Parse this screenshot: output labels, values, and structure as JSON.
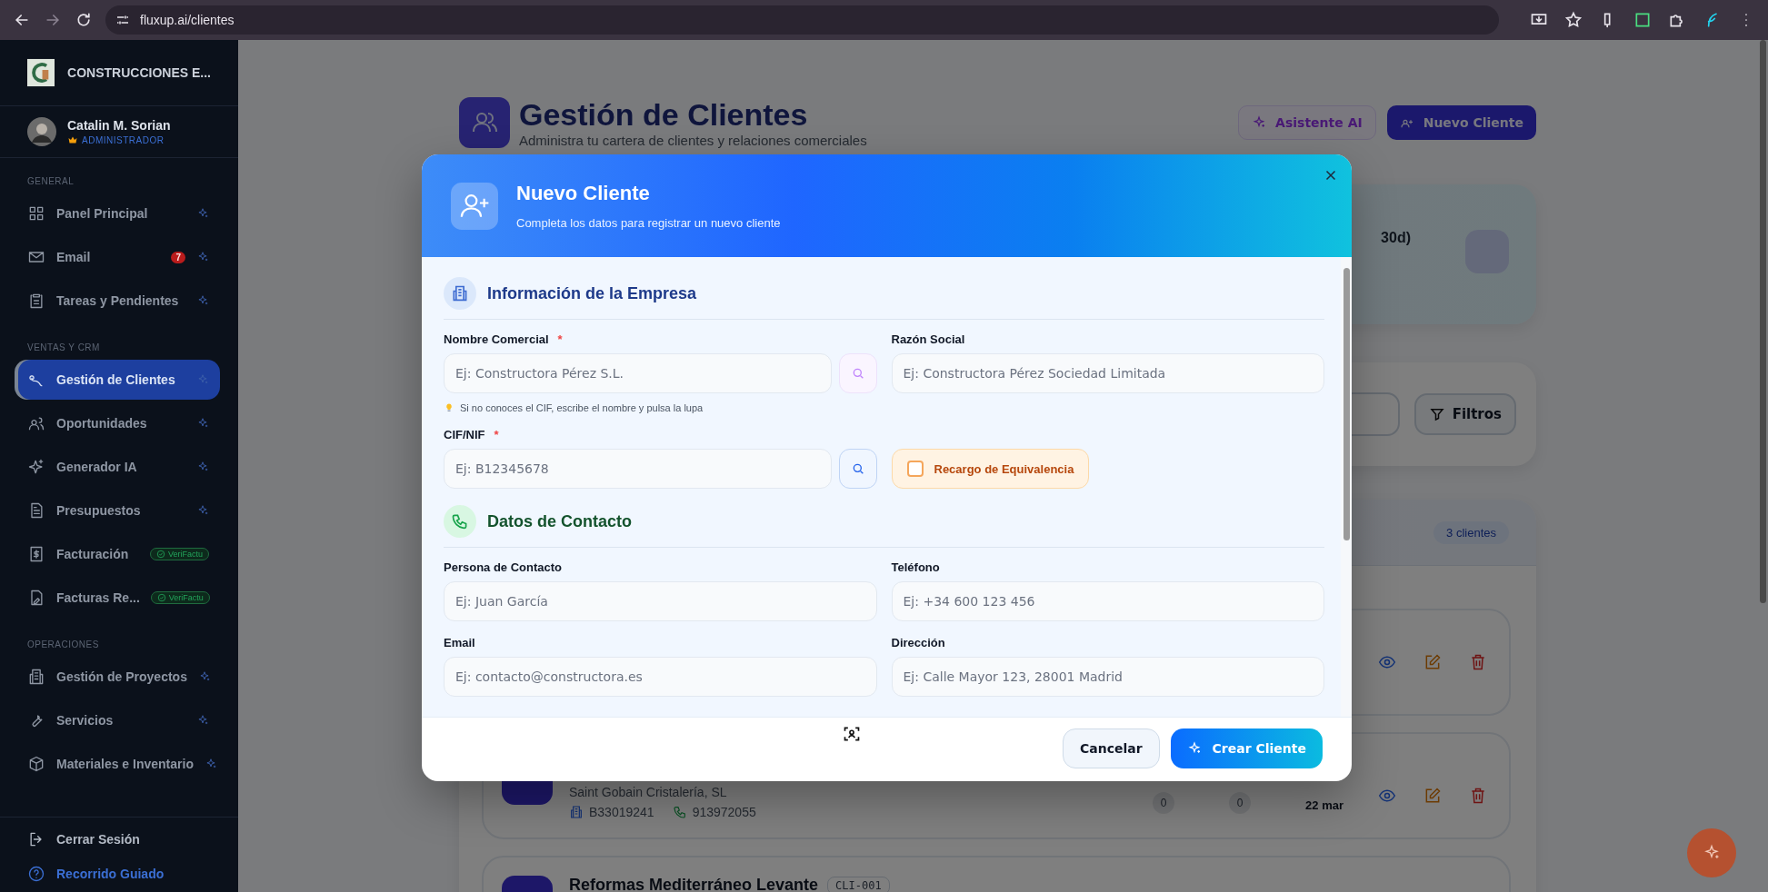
{
  "browser": {
    "url": "fluxup.ai/clientes"
  },
  "sidebar": {
    "company": "CONSTRUCCIONES E...",
    "user": {
      "name": "Catalin M. Sorian",
      "role": "ADMINISTRADOR"
    },
    "sections": [
      {
        "title": "GENERAL",
        "items": [
          {
            "label": "Panel Principal",
            "selected": false
          },
          {
            "label": "Email",
            "badge": "7",
            "selected": false
          },
          {
            "label": "Tareas y Pendientes",
            "selected": false
          }
        ]
      },
      {
        "title": "VENTAS Y CRM",
        "items": [
          {
            "label": "Gestión de Clientes",
            "selected": true
          },
          {
            "label": "Oportunidades",
            "selected": false
          },
          {
            "label": "Generador IA",
            "selected": false
          },
          {
            "label": "Presupuestos",
            "selected": false
          },
          {
            "label": "Facturación",
            "tag": "VeriFactu",
            "selected": false
          },
          {
            "label": "Facturas Re...",
            "tag": "VeriFactu",
            "selected": false
          }
        ]
      },
      {
        "title": "OPERACIONES",
        "items": [
          {
            "label": "Gestión de Proyectos",
            "selected": false
          },
          {
            "label": "Servicios",
            "selected": false
          },
          {
            "label": "Materiales e Inventario",
            "selected": false
          }
        ]
      }
    ],
    "footer": [
      {
        "label": "Cerrar Sesión",
        "kind": "logout"
      },
      {
        "label": "Recorrido Guiado",
        "kind": "guide"
      }
    ]
  },
  "page": {
    "title": "Gestión de Clientes",
    "subtitle": "Administra tu cartera de clientes y relaciones comerciales",
    "actions": [
      {
        "label": "Asistente AI",
        "kind": "ai"
      },
      {
        "label": "Nuevo Cliente",
        "kind": "primary"
      }
    ]
  },
  "stats_card": {
    "text": "30d)"
  },
  "filters": {
    "button": "Filtros"
  },
  "client_list": {
    "count": "3 clientes",
    "clients": [
      {
        "kind": "covered"
      },
      {
        "kind": "partial",
        "legal_name": "Saint Gobain Cristalería, SL",
        "cif": "B33019241",
        "phone": "913972055",
        "stats": [
          "0",
          "0"
        ],
        "created": "22 mar"
      },
      {
        "kind": "top",
        "name": "Reformas Mediterráneo Levante",
        "code": "CLI-001"
      }
    ]
  },
  "modal": {
    "title": "Nuevo Cliente",
    "subtitle": "Completa los datos para registrar un nuevo cliente",
    "sections": [
      {
        "title": "Información de la Empresa",
        "kind": "company",
        "fields": [
          {
            "label": "Nombre Comercial",
            "required_mark": "*",
            "placeholder": "Ej: Constructora Pérez S.L.",
            "kind": "lookup-ai",
            "hint": "Si no conoces el CIF, escribe el nombre y pulsa la lupa"
          },
          {
            "label": "Razón Social",
            "placeholder": "Ej: Constructora Pérez Sociedad Limitada",
            "kind": "text"
          },
          {
            "label": "CIF/NIF",
            "required_mark": "*",
            "placeholder": "Ej: B12345678",
            "kind": "lookup"
          },
          {
            "label": "Recargo de Equivalencia",
            "kind": "checkbox",
            "checked": false
          }
        ]
      },
      {
        "title": "Datos de Contacto",
        "kind": "contact",
        "fields": [
          {
            "label": "Persona de Contacto",
            "placeholder": "Ej: Juan García",
            "kind": "text"
          },
          {
            "label": "Teléfono",
            "placeholder": "Ej: +34 600 123 456",
            "kind": "text"
          },
          {
            "label": "Email",
            "placeholder": "Ej: contacto@constructora.es",
            "kind": "text"
          },
          {
            "label": "Dirección",
            "placeholder": "Ej: Calle Mayor 123, 28001 Madrid",
            "kind": "text"
          }
        ]
      }
    ],
    "buttons": [
      {
        "label": "Cancelar",
        "kind": "secondary"
      },
      {
        "label": "Crear Cliente",
        "kind": "primary"
      }
    ]
  }
}
